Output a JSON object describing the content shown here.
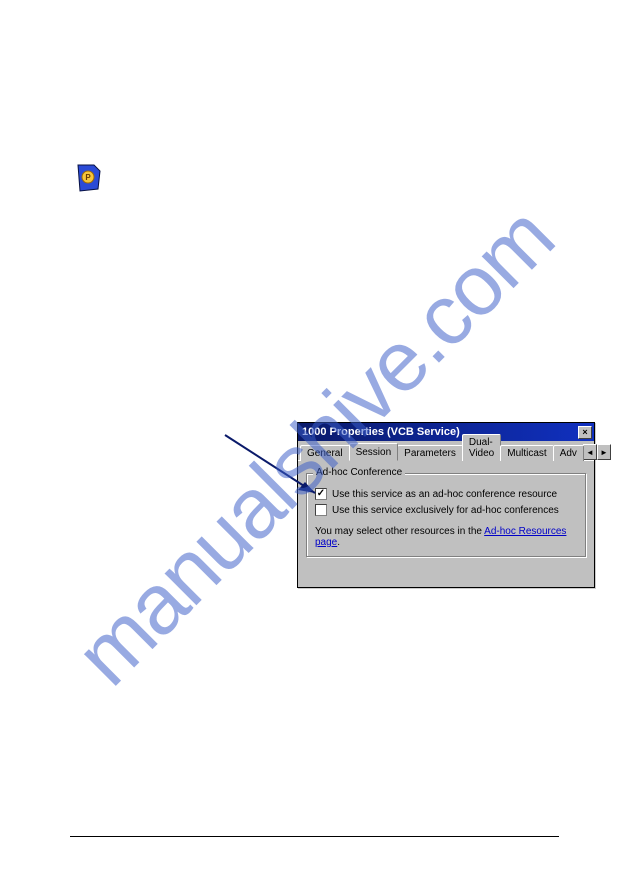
{
  "watermark": "manualshive.com",
  "dialog": {
    "title": "1000 Properties (VCB Service)",
    "tabs": [
      "General",
      "Session",
      "Parameters",
      "Dual-Video",
      "Multicast",
      "Adv"
    ],
    "activeTabIndex": 1,
    "groupbox": {
      "title": "Ad-hoc Conference",
      "checks": [
        {
          "label": "Use this service as an ad-hoc conference resource",
          "checked": true
        },
        {
          "label": "Use this service exclusively for ad-hoc conferences",
          "checked": false
        }
      ],
      "noteText": "You may select other resources in the ",
      "noteLink": "Ad-hoc Resources page",
      "notePeriod": "."
    }
  },
  "symbols": {
    "scrollLeft": "◄",
    "scrollRight": "►",
    "close": "×"
  }
}
